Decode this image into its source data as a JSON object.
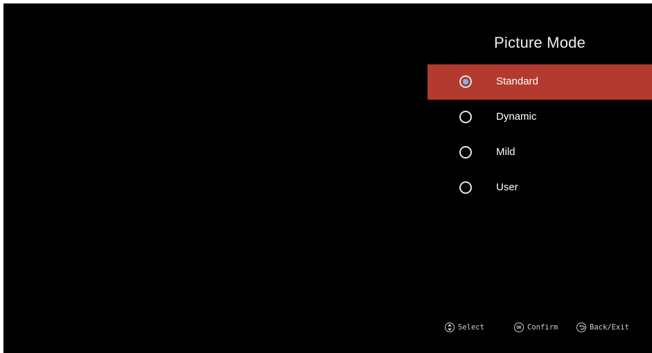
{
  "menu": {
    "title": "Picture Mode",
    "options": [
      {
        "label": "Standard",
        "selected": true
      },
      {
        "label": "Dynamic",
        "selected": false
      },
      {
        "label": "Mild",
        "selected": false
      },
      {
        "label": "User",
        "selected": false
      }
    ]
  },
  "footer": {
    "select_label": "Select",
    "confirm_label": "Confirm",
    "ok_badge": "OK",
    "back_label": "Back/Exit"
  },
  "icons": {
    "select": "updown-icon",
    "confirm": "ok-icon",
    "back": "back-icon"
  },
  "colors": {
    "highlight": "#b23a2e",
    "selected_dot": "#7fb8e6",
    "background": "#000000"
  }
}
